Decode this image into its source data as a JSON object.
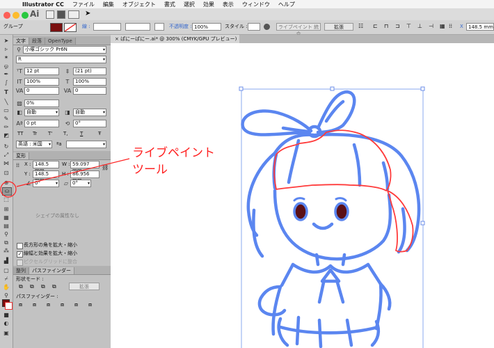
{
  "menubar": {
    "app_name": "Illustrator CC",
    "items": [
      "ファイル",
      "編集",
      "オブジェクト",
      "書式",
      "選択",
      "効果",
      "表示",
      "ウィンドウ",
      "ヘルプ"
    ]
  },
  "appbar": {
    "logo": "Ai"
  },
  "control_bar": {
    "selection_label": "グループ",
    "stroke_label": "線 :",
    "opacity_label": "不透明度 :",
    "opacity_value": "100%",
    "style_label": "スタイル :",
    "live_paint_button": "ライブペイント 統合",
    "expand_button": "拡張",
    "x_label": "X",
    "x_value": "148.5 mm"
  },
  "document": {
    "tab_title": "ぱにーぱにー.ai* @ 300% (CMYK/GPU プレビュー)",
    "close_glyph": "×"
  },
  "character_panel": {
    "tabs": [
      "文字",
      "段落",
      "OpenType"
    ],
    "font_family": "小塚ゴシック Pr6N",
    "font_style": "R",
    "font_size": "12 pt",
    "leading": "(21 pt)",
    "vertical_scale": "100%",
    "horizontal_scale": "100%",
    "kerning": "0",
    "tracking": "0",
    "tsume": "0%",
    "aki_left": "自動",
    "aki_right": "自動",
    "baseline_shift": "0 pt",
    "rotation": "0°",
    "style_buttons": [
      "TT",
      "Tr",
      "T'",
      "T,",
      "T",
      "Ŧ"
    ],
    "language": "英語 : 米国",
    "antialias": "ªa"
  },
  "transform_panel": {
    "tab": "変形",
    "x_label": "X :",
    "x_value": "148.5 mm",
    "y_label": "Y :",
    "y_value": "148.5 mm",
    "w_label": "W :",
    "w_value": "59.097 mm",
    "h_label": "H :",
    "h_value": "86.956 mm",
    "angle_value": "0°",
    "shear_value": "0°",
    "no_shape_text": "シェイプの属性なし",
    "options": [
      {
        "label": "長方形の角を拡大・縮小",
        "checked": false
      },
      {
        "label": "線幅と効果を拡大・縮小",
        "checked": true
      },
      {
        "label": "ピクセルグリッドに整合",
        "checked": false
      }
    ]
  },
  "pathfinder_panel": {
    "tabs": [
      "整列",
      "パスファインダー"
    ],
    "shape_modes_label": "形状モード :",
    "expand_button": "拡張",
    "pathfinders_label": "パスファインダー :"
  },
  "callout": {
    "line1": "ライブペイント",
    "line2": "ツール"
  },
  "colors": {
    "accent_red": "#ff2222",
    "path_blue": "#5b86f0",
    "selection_blue": "#8aa8ef"
  }
}
